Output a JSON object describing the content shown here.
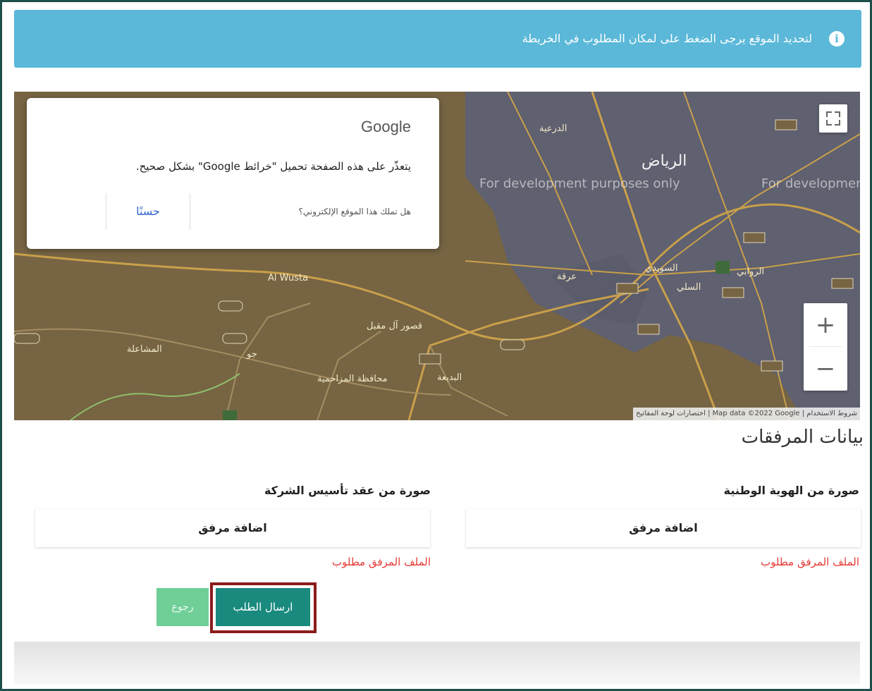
{
  "info_bar": {
    "text": "لتحديد الموقع يرجى الضغط على لمكان المطلوب في الخريطة",
    "icon": "info-icon"
  },
  "map": {
    "city_label": "الرياض",
    "labels": [
      "الدرعية",
      "عرقة",
      "السويدي",
      "السلي",
      "الروابي",
      "Al Wusta",
      "قصور آل مقبل",
      "المزاحمية",
      "محافظة المزاحمية",
      "جو",
      "البديعة",
      "المشاعلة"
    ],
    "dev_watermark": "For development purposes only",
    "attribution": "اختصارات لوحة المفاتيح | Map data ©2022 Google | شروط الاستخدام",
    "zoom_in": "+",
    "zoom_out": "−",
    "fullscreen_icon": "fullscreen-icon"
  },
  "google_dialog": {
    "title": "Google",
    "message": "يتعذّر على هذه الصفحة تحميل \"خرائط Google\" بشكل صحيح.",
    "owner_question": "هل تملك هذا الموقع الإلكتروني؟",
    "ok_label": "حسنًا"
  },
  "attachments": {
    "section_title": "بيانات المرفقات",
    "national_id": {
      "label": "صورة من الهوية الوطنية",
      "button": "اضافة مرفق",
      "error": "الملف المرفق مطلوب"
    },
    "company_contract": {
      "label": "صورة من عقد تأسيس الشركة",
      "button": "اضافة مرفق",
      "error": "الملف المرفق مطلوب"
    }
  },
  "actions": {
    "submit_label": "ارسال الطلب",
    "back_label": "رجوع"
  }
}
